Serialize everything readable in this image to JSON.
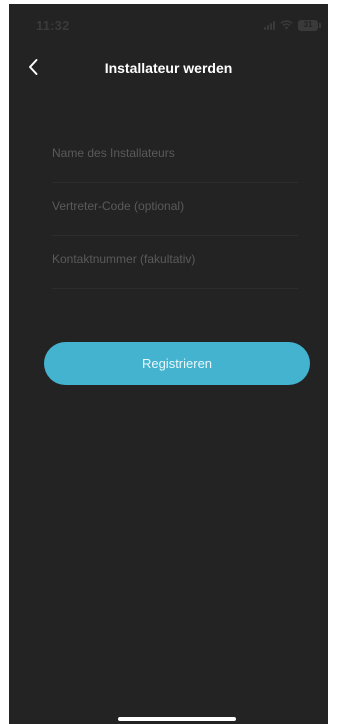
{
  "status_bar": {
    "time": "11:32",
    "battery_level": "31",
    "icons": [
      "signal-icon",
      "wifi-icon",
      "battery-icon"
    ]
  },
  "header": {
    "title": "Installateur werden",
    "back_icon": "chevron-left-icon"
  },
  "form": {
    "installer_name": {
      "value": "",
      "placeholder": "Name des Installateurs"
    },
    "agent_code": {
      "value": "",
      "placeholder": "Vertreter-Code (optional)"
    },
    "contact_number": {
      "value": "",
      "placeholder": "Kontaktnummer (fakultativ)"
    }
  },
  "actions": {
    "register_label": "Registrieren"
  },
  "colors": {
    "background": "#232323",
    "accent": "#43b3cf",
    "title_text": "#ffffff",
    "placeholder_text": "#5a5a5a"
  }
}
